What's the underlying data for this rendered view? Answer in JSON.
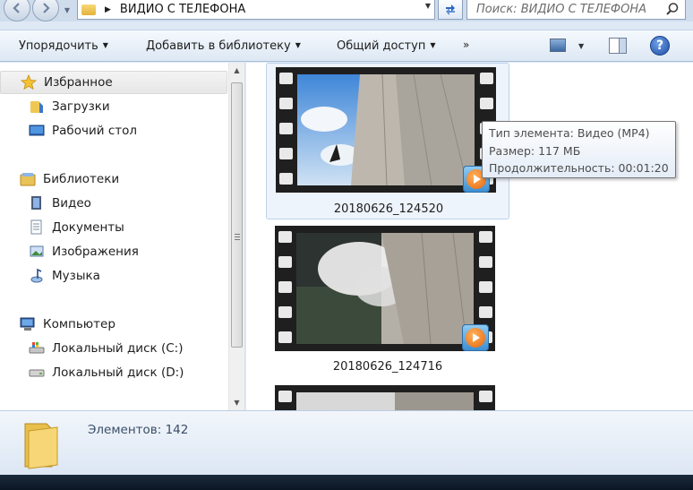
{
  "address_bar": {
    "path": "ВИДИО С ТЕЛЕФОНА",
    "search_placeholder": "Поиск: ВИДИО С ТЕЛЕФОНА"
  },
  "toolbar": {
    "organize": "Упорядочить",
    "add_to_library": "Добавить в библиотеку",
    "share": "Общий доступ",
    "more": "»",
    "help": "?"
  },
  "nav": {
    "favorites": "Избранное",
    "downloads": "Загрузки",
    "desktop": "Рабочий стол",
    "libraries": "Библиотеки",
    "video": "Видео",
    "documents": "Документы",
    "images": "Изображения",
    "music": "Музыка",
    "computer": "Компьютер",
    "disk_c": "Локальный диск (C:)",
    "disk_d": "Локальный диск (D:)"
  },
  "files": [
    {
      "name": "20180626_124520"
    },
    {
      "name": "20180626_124716"
    },
    {
      "name": ""
    }
  ],
  "tooltip": {
    "type": "Тип элемента: Видео (MP4)",
    "size": "Размер: 117 МБ",
    "duration": "Продолжительность: 00:01:20"
  },
  "details": {
    "count": "Элементов: 142"
  }
}
